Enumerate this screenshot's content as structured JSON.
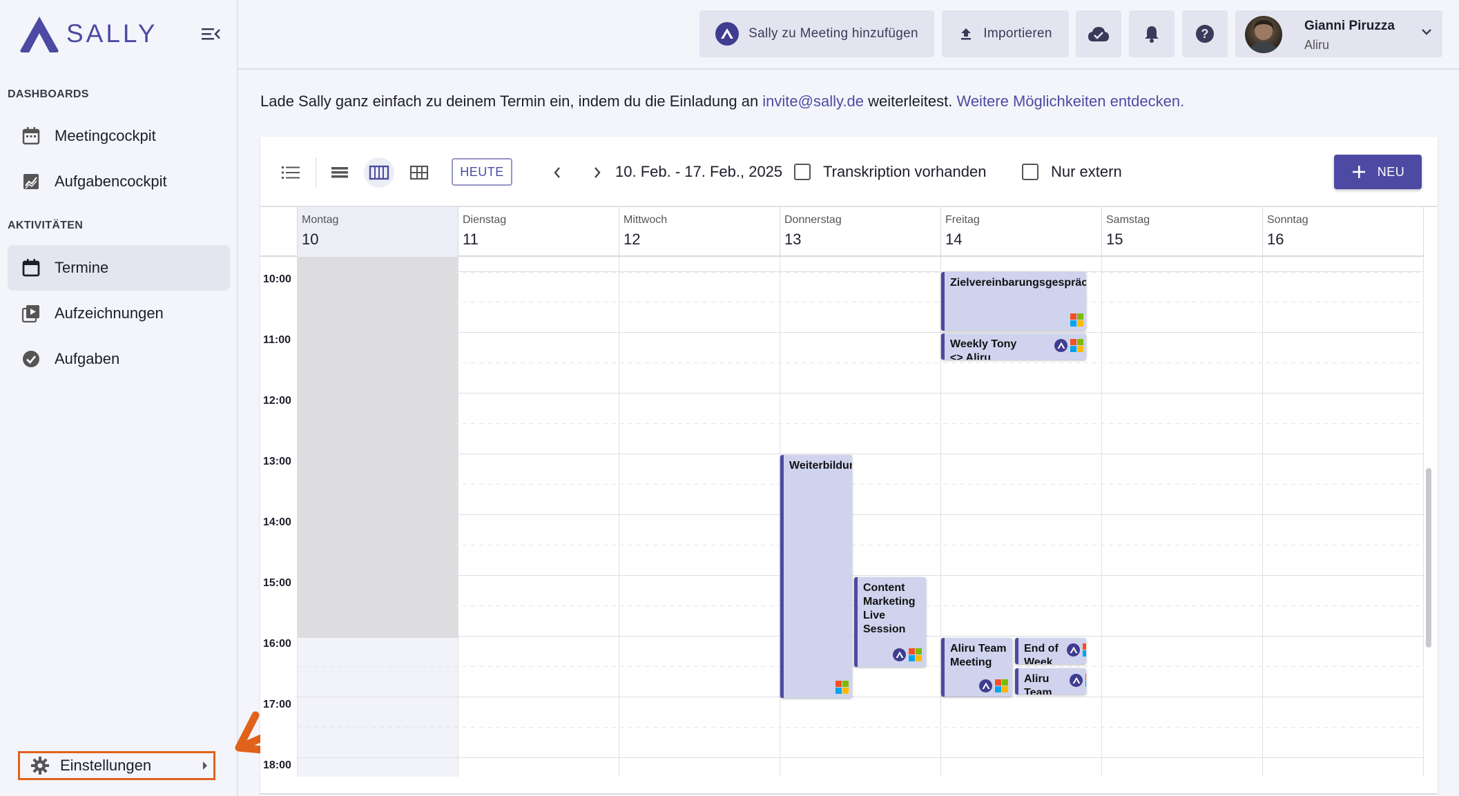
{
  "app": {
    "name": "SALLY"
  },
  "sidebar": {
    "sections": [
      {
        "label": "DASHBOARDS",
        "items": [
          {
            "label": "Meetingcockpit",
            "icon": "calendar-dashboard-icon"
          },
          {
            "label": "Aufgabencockpit",
            "icon": "chart-icon"
          }
        ]
      },
      {
        "label": "AKTIVITÄTEN",
        "items": [
          {
            "label": "Termine",
            "icon": "calendar-icon",
            "active": true
          },
          {
            "label": "Aufzeichnungen",
            "icon": "recording-icon"
          },
          {
            "label": "Aufgaben",
            "icon": "check-circle-icon"
          }
        ]
      }
    ],
    "settings_label": "Einstellungen"
  },
  "topbar": {
    "add_to_meeting": "Sally zu Meeting hinzufügen",
    "import": "Importieren",
    "user": {
      "name": "Gianni Piruzza",
      "org": "Aliru"
    }
  },
  "info": {
    "prefix": "Lade Sally ganz einfach zu deinem Termin ein, indem du die Einladung an ",
    "email": "invite@sally.de",
    "middle": " weiterleitest. ",
    "link": "Weitere Möglichkeiten entdecken."
  },
  "calendar": {
    "today_label": "HEUTE",
    "date_range": "10. Feb. - 17. Feb., 2025",
    "filter_transcript": "Transkription vorhanden",
    "filter_external": "Nur extern",
    "new_label": "NEU",
    "days": [
      {
        "name": "Montag",
        "date": "10"
      },
      {
        "name": "Dienstag",
        "date": "11"
      },
      {
        "name": "Mittwoch",
        "date": "12"
      },
      {
        "name": "Donnerstag",
        "date": "13"
      },
      {
        "name": "Freitag",
        "date": "14"
      },
      {
        "name": "Samstag",
        "date": "15"
      },
      {
        "name": "Sonntag",
        "date": "16"
      }
    ],
    "times": [
      "10:00",
      "11:00",
      "12:00",
      "13:00",
      "14:00",
      "15:00",
      "16:00",
      "17:00",
      "18:00"
    ],
    "events": [
      {
        "title": "Zielvereinbarungsgespräch",
        "day": "Freitag",
        "start": "10:00",
        "end": "11:00"
      },
      {
        "title": "Weekly Tony <> Aliru",
        "day": "Freitag",
        "start": "11:00",
        "end": "11:30"
      },
      {
        "title": "Weiterbildung",
        "day": "Donnerstag",
        "start": "13:00",
        "end": "17:00"
      },
      {
        "title": "Content Marketing Live Session",
        "day": "Donnerstag",
        "start": "15:00",
        "end": "16:30"
      },
      {
        "title": "Aliru Team Meeting",
        "day": "Freitag",
        "start": "16:00",
        "end": "17:00"
      },
      {
        "title": "End of Week",
        "day": "Freitag",
        "start": "16:00",
        "end": "16:30"
      },
      {
        "title": "Aliru Team",
        "day": "Freitag",
        "start": "16:30",
        "end": "17:00"
      }
    ]
  }
}
